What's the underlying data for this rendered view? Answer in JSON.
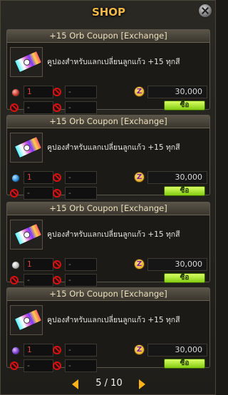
{
  "window": {
    "title": "SHOP"
  },
  "items": [
    {
      "name": "+15 Orb Coupon [Exchange]",
      "description": "คูปองสำหรับแลกเปลี่ยนลูกแก้ว +15 ทุกสี",
      "quantity": "1",
      "slot_2": "-",
      "slot_3": "-",
      "slot_4": "-",
      "price": "30,000",
      "buy_label": "ซื้อ",
      "orb_color": "#c93a2b"
    },
    {
      "name": "+15 Orb Coupon [Exchange]",
      "description": "คูปองสำหรับแลกเปลี่ยนลูกแก้ว +15 ทุกสี",
      "quantity": "1",
      "slot_2": "-",
      "slot_3": "-",
      "slot_4": "-",
      "price": "30,000",
      "buy_label": "ซื้อ",
      "orb_color": "#2c8de0"
    },
    {
      "name": "+15 Orb Coupon [Exchange]",
      "description": "คูปองสำหรับแลกเปลี่ยนลูกแก้ว +15 ทุกสี",
      "quantity": "1",
      "slot_2": "-",
      "slot_3": "-",
      "slot_4": "-",
      "price": "30,000",
      "buy_label": "ซื้อ",
      "orb_color": "#bdbdbd"
    },
    {
      "name": "+15 Orb Coupon [Exchange]",
      "description": "คูปองสำหรับแลกเปลี่ยนลูกแก้ว +15 ทุกสี",
      "quantity": "1",
      "slot_2": "-",
      "slot_3": "-",
      "slot_4": "-",
      "price": "30,000",
      "buy_label": "ซื้อ",
      "orb_color": "#7b3fd1"
    }
  ],
  "pagination": {
    "label": "5 / 10",
    "current": 5,
    "total": 10
  },
  "icons": {
    "close": "close-icon",
    "coupon": "coupon-ticket-icon",
    "unavailable": "prohibited-icon",
    "currency": "z-coin-icon",
    "prev": "left-arrow-icon",
    "next": "right-arrow-icon"
  },
  "colors": {
    "title": "#f0b84a",
    "buy_button": "#a6e52b",
    "prohibited": "#d51313",
    "quantity": "#e04343",
    "arrows": "#ffb21a"
  }
}
